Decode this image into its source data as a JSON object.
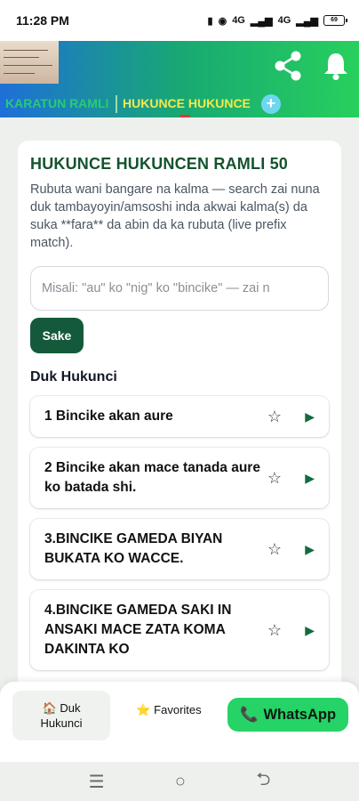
{
  "status": {
    "time": "11:28 PM",
    "net1": "4G",
    "net2": "4G",
    "battery": "69"
  },
  "tabs": [
    {
      "label": "KARATUN RAMLI"
    },
    {
      "label": "HUKUNCE HUKUNCE"
    }
  ],
  "tab_add": "+",
  "card": {
    "title": "HUKUNCE HUKUNCEN RAMLI 50",
    "description": "Rubuta wani bangare na kalma — search zai nuna duk tambayoyin/amsoshi inda akwai kalma(s) da suka **fara** da abin da ka rubuta (live prefix match).",
    "search_placeholder": "Misali: \"au\" ko \"nig\" ko \"bincike\" — zai n",
    "search_button": "Sake",
    "list_header": "Duk Hukunci"
  },
  "items": [
    {
      "title": "1 Bincike akan aure"
    },
    {
      "title": "2 Bincike akan mace tanada aure ko batada shi."
    },
    {
      "title": "3.BINCIKE GAMEDA BIYAN BUKATA KO WACCE."
    },
    {
      "title": "4.BINCIKE GAMEDA SAKI IN ANSAKI MACE ZATA KOMA DAKINTA KO"
    }
  ],
  "item_icons": {
    "favorite": "☆",
    "play": "▶"
  },
  "bottom_nav": {
    "home_icon": "🏠",
    "home_line1": "Duk",
    "home_line2": "Hukunci",
    "fav_icon": "⭐",
    "fav_label": "Favorites",
    "wa_icon": "📞",
    "wa_label": "WhatsApp"
  },
  "system_nav": {
    "menu": "☰",
    "home": "○",
    "back": "⮌"
  },
  "colors": {
    "primary_dark": "#145a3a",
    "title_green": "#14532d",
    "whatsapp": "#25d366",
    "tab_active": "#f5e94a"
  }
}
